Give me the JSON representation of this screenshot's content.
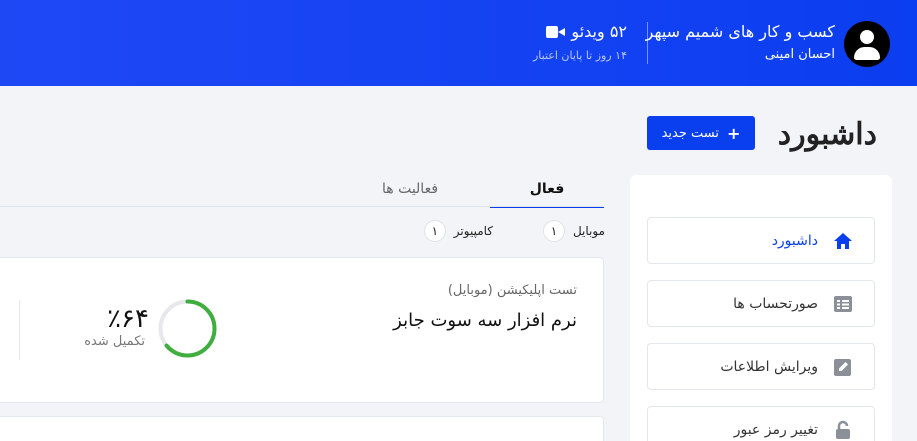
{
  "header": {
    "company": "کسب و کار های شمیم سپهر",
    "user": "احسان امینی",
    "videos": "۵۲ ویدئو",
    "credit_days": "۱۴ روز تا پایان اعتبار"
  },
  "logo_text": "داشبورد",
  "new_test_label": "تست جدید",
  "sidebar": {
    "items": [
      {
        "label": "داشبورد",
        "icon": "home-icon",
        "active": true
      },
      {
        "label": "صورتحساب ها",
        "icon": "invoice-list-icon",
        "active": false
      },
      {
        "label": "ویرایش اطلاعات",
        "icon": "edit-icon",
        "active": false
      },
      {
        "label": "تغییر رمز عبور",
        "icon": "lock-icon",
        "active": false
      }
    ]
  },
  "tabs": {
    "active": "فعال",
    "activities": "فعالیت ها"
  },
  "devices": {
    "mobile_label": "موبایل",
    "mobile_count": "۱",
    "computer_label": "کامپیوتر",
    "computer_count": "۱"
  },
  "test_card": {
    "type": "تست اپلیکیشن (موبایل)",
    "name": "نرم افزار سه سوت جابز",
    "percent_text": "٪۶۴",
    "completed_label": "تکمیل شده",
    "progress": 0.64
  },
  "colors": {
    "brand_blue": "#0a3ff0",
    "progress_green": "#3fae3f"
  }
}
